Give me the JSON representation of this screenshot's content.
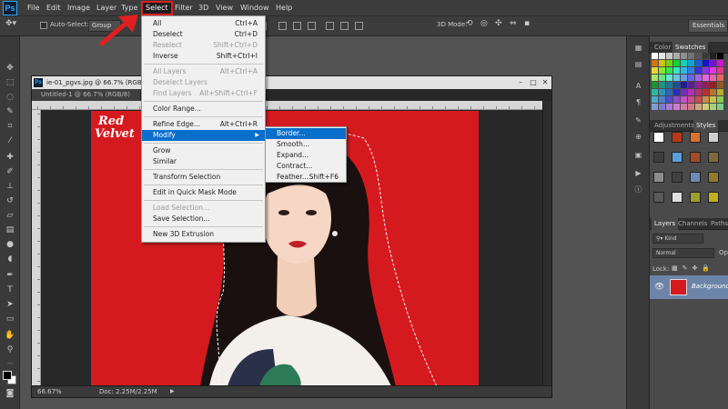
{
  "menubar": {
    "logo": "Ps",
    "items": [
      "File",
      "Edit",
      "Image",
      "Layer",
      "Type",
      "Select",
      "Filter",
      "3D",
      "View",
      "Window",
      "Help"
    ]
  },
  "options_bar": {
    "auto_select_label": "Auto-Select:",
    "auto_select_value": "Group",
    "mode_3d_label": "3D Mode:",
    "workspace": "Essentials"
  },
  "select_menu": {
    "items": [
      {
        "label": "All",
        "shortcut": "Ctrl+A"
      },
      {
        "label": "Deselect",
        "shortcut": "Ctrl+D"
      },
      {
        "label": "Reselect",
        "shortcut": "Shift+Ctrl+D"
      },
      {
        "label": "Inverse",
        "shortcut": "Shift+Ctrl+I"
      },
      {
        "label": "All Layers",
        "shortcut": "Alt+Ctrl+A"
      },
      {
        "label": "Deselect Layers",
        "shortcut": ""
      },
      {
        "label": "Find Layers",
        "shortcut": "Alt+Shift+Ctrl+F"
      },
      {
        "label": "Color Range...",
        "shortcut": ""
      },
      {
        "label": "Refine Edge...",
        "shortcut": "Alt+Ctrl+R"
      },
      {
        "label": "Modify",
        "shortcut": ""
      },
      {
        "label": "Grow",
        "shortcut": ""
      },
      {
        "label": "Similar",
        "shortcut": ""
      },
      {
        "label": "Transform Selection",
        "shortcut": ""
      },
      {
        "label": "Edit in Quick Mask Mode",
        "shortcut": ""
      },
      {
        "label": "Load Selection...",
        "shortcut": ""
      },
      {
        "label": "Save Selection...",
        "shortcut": ""
      },
      {
        "label": "New 3D Extrusion",
        "shortcut": ""
      }
    ]
  },
  "modify_submenu": {
    "items": [
      {
        "label": "Border...",
        "shortcut": ""
      },
      {
        "label": "Smooth...",
        "shortcut": ""
      },
      {
        "label": "Expand...",
        "shortcut": ""
      },
      {
        "label": "Contract...",
        "shortcut": ""
      },
      {
        "label": "Feather...",
        "shortcut": "Shift+F6"
      }
    ]
  },
  "document": {
    "title": "ie-01_pgvs.jpg @ 66.7% (RGB/8)",
    "icon": "Ps",
    "tab": "Untitled-1 @ 66.7% (RGB/8)",
    "zoom": "66.67%",
    "doc_size": "Doc: 2.25M/2.25M",
    "photo_text_line1": "Red",
    "photo_text_line2": "Velvet"
  },
  "panels": {
    "color_tabs": [
      "Color",
      "Swatches"
    ],
    "style_tabs": [
      "Adjustments",
      "Styles"
    ],
    "layer_tabs": [
      "Layers",
      "Channels",
      "Paths"
    ],
    "kind_label": "Kind",
    "blend_mode": "Normal",
    "opacity_label": "Op",
    "lock_label": "Lock:",
    "layer_name": "Background"
  },
  "colors": {
    "select_highlight": "#0a6ecb",
    "annotation_red": "#e02020",
    "photo_red": "#d51a1f"
  }
}
